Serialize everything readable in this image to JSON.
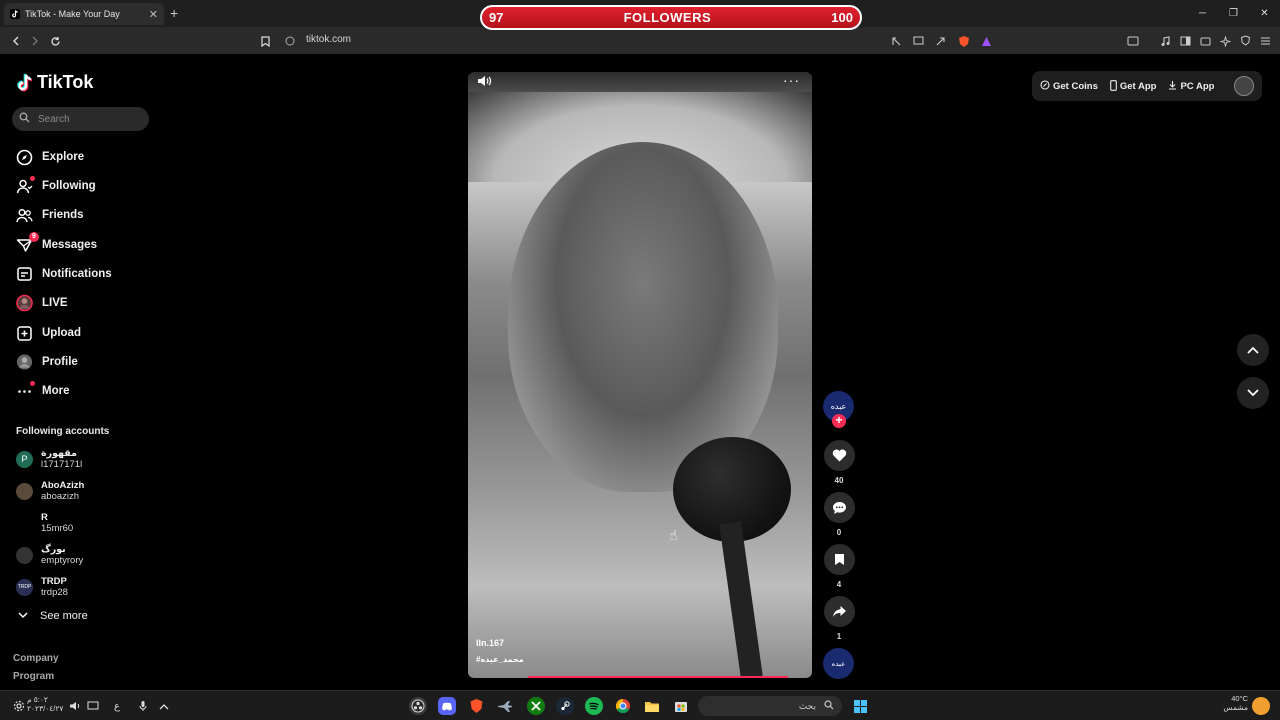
{
  "browser": {
    "tab_title": "TikTok - Make Your Day",
    "tab_close": "✕",
    "new_tab": "+",
    "url": "tiktok.com",
    "window_controls": [
      "─",
      "❐",
      "✕"
    ]
  },
  "overlay": {
    "left_count": "97",
    "label": "FOLLOWERS",
    "right_count": "100"
  },
  "brand": {
    "logo_text": "TikTok",
    "accent": "#fe2c55"
  },
  "search": {
    "placeholder": "Search"
  },
  "menu": {
    "explore": "Explore",
    "following": "Following",
    "friends": "Friends",
    "messages": "Messages",
    "messages_badge": "9",
    "notifications": "Notifications",
    "live": "LIVE",
    "upload": "Upload",
    "profile": "Profile",
    "more": "More"
  },
  "following_accounts": {
    "title": "Following accounts",
    "items": [
      {
        "display": "مقهورة",
        "username": "l1717171l",
        "avatar": "P"
      },
      {
        "display": "AboAzizh",
        "username": "aboazizh",
        "avatar": ""
      },
      {
        "display": "R",
        "username": "15mr60",
        "avatar": ""
      },
      {
        "display": "بورگ",
        "username": "emptyrory",
        "avatar": ""
      },
      {
        "display": "TRDP",
        "username": "trdp28",
        "avatar": "TRDP"
      }
    ],
    "see_more": "See more"
  },
  "footer": {
    "company": "Company",
    "program": "Program"
  },
  "video": {
    "author": "lln.167",
    "tags": "#محمد_عبده",
    "more": "···"
  },
  "actions": {
    "avatar_text": "عبده",
    "follow_plus": "+",
    "likes": "40",
    "comments": "0",
    "saves": "4",
    "shares": "1",
    "sound_text": "عبده"
  },
  "top_right": {
    "get_coins": "Get Coins",
    "get_app": "Get App",
    "pc_app": "PC App"
  },
  "taskbar": {
    "time": "٥:٠٢ م",
    "date": "٢٠٢٣/٠٤/٢٧",
    "search_text": "بحث",
    "lang": "ع",
    "weather_temp": "40°C",
    "weather_text": "مشمس"
  }
}
